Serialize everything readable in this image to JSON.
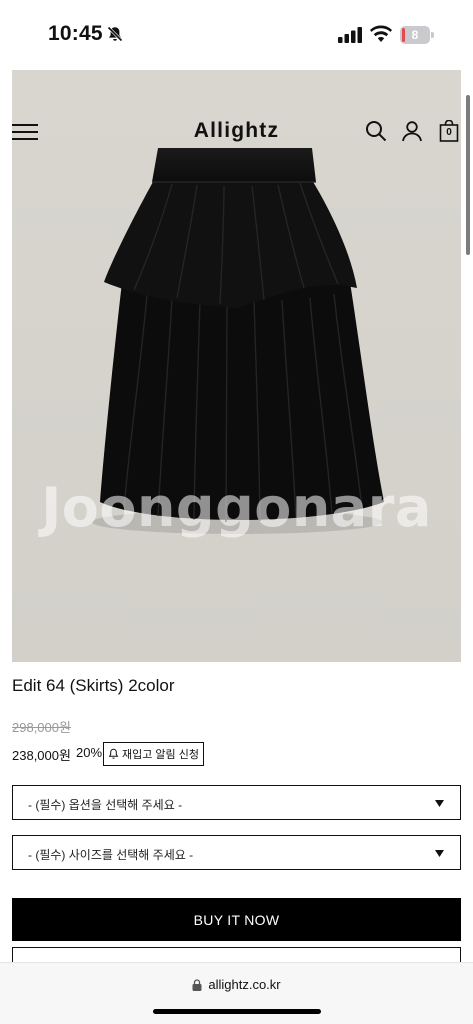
{
  "status_bar": {
    "time": "10:45",
    "battery": "8",
    "battery_level": 0.08,
    "battery_color": "#e5484d"
  },
  "header": {
    "logo": "Allightz",
    "cart_count": "0",
    "icons": [
      "hamburger-menu-icon",
      "search-icon",
      "account-icon",
      "shopping-bag-icon"
    ]
  },
  "product": {
    "watermark": "Joonggonara",
    "title": "Edit 64 (Skirts) 2color",
    "original_price": "298,000원",
    "sale_price": "238,000원",
    "discount": "20%",
    "restock_label": "재입고 알림 신청"
  },
  "options": {
    "color_select": "- (필수) 옵션을 선택해 주세요 -",
    "size_select": "- (필수) 사이즈를 선택해 주세요 -"
  },
  "actions": {
    "buy_now": "BUY IT NOW"
  },
  "browser": {
    "url": "allightz.co.kr"
  },
  "colors": {
    "hero_background": "#d7d5cf",
    "buy_button": "#000000",
    "accent_text": "#111111"
  }
}
